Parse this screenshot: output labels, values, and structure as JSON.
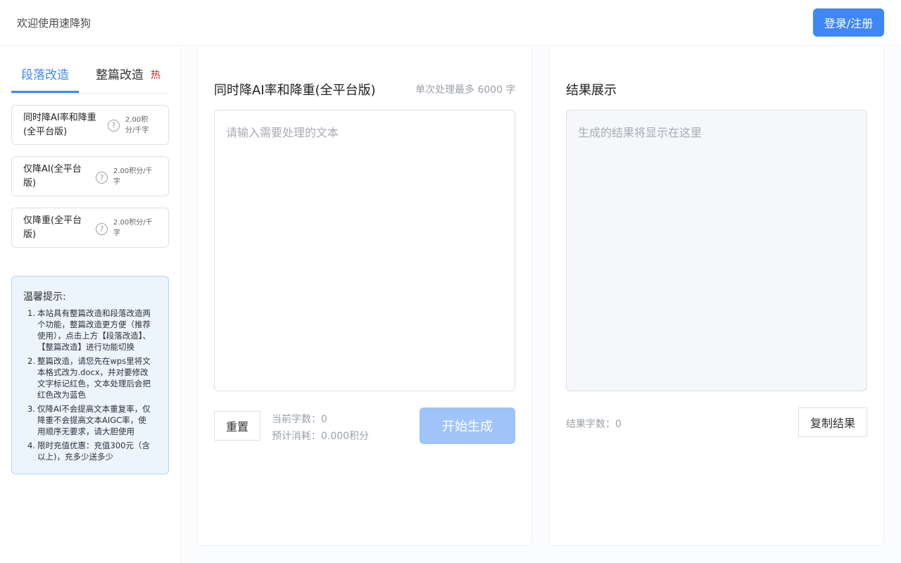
{
  "header": {
    "welcome": "欢迎使用速降狗",
    "login_label": "登录/注册"
  },
  "sidebar": {
    "tabs": [
      {
        "label": "段落改造",
        "active": true
      },
      {
        "label": "整篇改造",
        "badge": "热"
      }
    ],
    "modes": [
      {
        "name_lines": [
          "同时降AI率和降重",
          "(全平台版)"
        ],
        "help": "?",
        "price_lines": [
          "2.00积",
          "分/千字"
        ]
      },
      {
        "name_lines": [
          "仅降AI(全平台",
          "版)"
        ],
        "help": "?",
        "price_lines": [
          "2.00积分/千",
          "字"
        ]
      },
      {
        "name_lines": [
          "仅降重(全平台",
          "版)"
        ],
        "help": "?",
        "price_lines": [
          "2.00积分/千",
          "字"
        ]
      }
    ],
    "tips": {
      "title": "温馨提示:",
      "items": [
        {
          "num": "1.",
          "lines": [
            "本站具有整篇改造和段落改造两",
            "个功能，整篇改造更方便（推荐",
            "使用），点击上方【段落改造】、",
            "【整篇改造】进行功能切换"
          ]
        },
        {
          "num": "2.",
          "lines": [
            "整篇改造，请您先在wps里将文",
            "本格式改为.docx，并对要修改",
            "文字标记红色，文本处理后会把",
            "红色改为蓝色"
          ]
        },
        {
          "num": "3.",
          "lines": [
            "仅降AI不会提高文本重复率，仅",
            "降重不会提高文本AIGC率，使",
            "用顺序无要求，请大胆使用"
          ]
        },
        {
          "num": "4.",
          "lines": [
            "限时充值优惠：充值300元（含",
            "以上)，充多少送多少"
          ]
        }
      ]
    }
  },
  "input_panel": {
    "title": "同时降AI率和降重(全平台版)",
    "limit_hint": "单次处理最多 6000 字",
    "placeholder": "请输入需要处理的文本",
    "reset_label": "重置",
    "char_count": "当前字数：0",
    "estimated_cost": "预计消耗：0.000积分",
    "generate_label": "开始生成"
  },
  "result_panel": {
    "title": "结果展示",
    "placeholder": "生成的结果将显示在这里",
    "result_count": "结果字数：0",
    "copy_label": "复制结果"
  },
  "colors": {
    "accent": "#3f87f5",
    "accent_disabled": "#a0c3f9",
    "hot": "#e0201f",
    "tips_bg": "#ecf4fe",
    "tips_border": "#b3d3fa"
  }
}
